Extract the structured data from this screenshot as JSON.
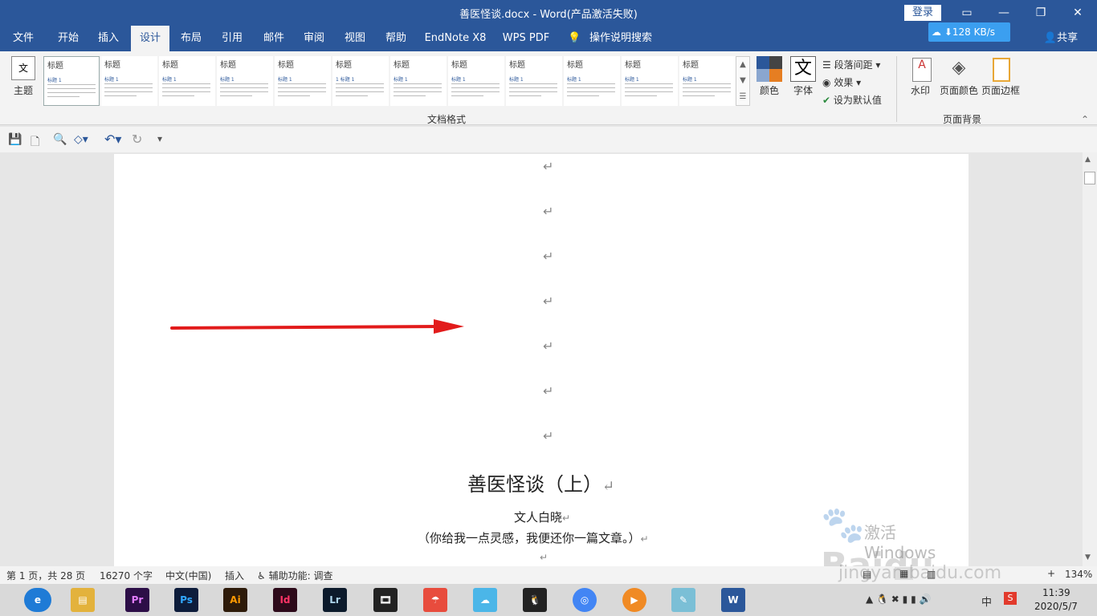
{
  "window": {
    "title": "善医怪谈.docx  -  Word(产品激活失败)",
    "login": "登录",
    "share": "共享",
    "net_speed": "128 KB/s"
  },
  "tabs": [
    "文件",
    "开始",
    "插入",
    "设计",
    "布局",
    "引用",
    "邮件",
    "审阅",
    "视图",
    "帮助",
    "EndNote X8",
    "WPS PDF",
    "操作说明搜索"
  ],
  "ribbon": {
    "theme_label": "主题",
    "styles_thumbs": [
      {
        "title": "标题",
        "subtitle": "标题 1"
      },
      {
        "title": "标题",
        "subtitle": "标题 1"
      },
      {
        "title": "标题",
        "subtitle": "标题 1"
      },
      {
        "title": "标题",
        "subtitle": "标题 1"
      },
      {
        "title": "标题",
        "subtitle": "标题 1"
      },
      {
        "title": "标题",
        "subtitle": "1  标题 1"
      },
      {
        "title": "标题",
        "subtitle": "标题 1"
      },
      {
        "title": "标题",
        "subtitle": "标题 1"
      },
      {
        "title": "标题",
        "subtitle": "标题 1"
      },
      {
        "title": "标题",
        "subtitle": "标题 1"
      },
      {
        "title": "标题",
        "subtitle": "标题 1"
      },
      {
        "title": "标题",
        "subtitle": "标题 1"
      }
    ],
    "group_doc_format": "文档格式",
    "colors": "颜色",
    "fonts": "字体",
    "paragraph_spacing": "段落间距",
    "effects": "效果",
    "set_default": "设为默认值",
    "watermark": "水印",
    "page_color": "页面颜色",
    "page_border": "页面边框",
    "group_page_bg": "页面背景"
  },
  "document": {
    "heading": "善医怪谈（上）",
    "author": "文人白晓",
    "subtitle": "（你给我一点灵感，我便还你一篇文章。）",
    "paragraph_mark": "↵"
  },
  "watermark": {
    "activate": "激活 Windows",
    "baidu": "Baidu经验",
    "url": "jingyan.baidu.com"
  },
  "status": {
    "page": "第 1 页，共 28 页",
    "words": "16270 个字",
    "language": "中文(中国)",
    "mode": "插入",
    "accessibility": "辅助功能: 调查",
    "zoom": "134%"
  },
  "taskbar": {
    "time": "11:39",
    "date": "2020/5/7",
    "ime": "中",
    "apps": [
      "Pr",
      "Ps",
      "Ai",
      "Id",
      "Lr"
    ]
  }
}
